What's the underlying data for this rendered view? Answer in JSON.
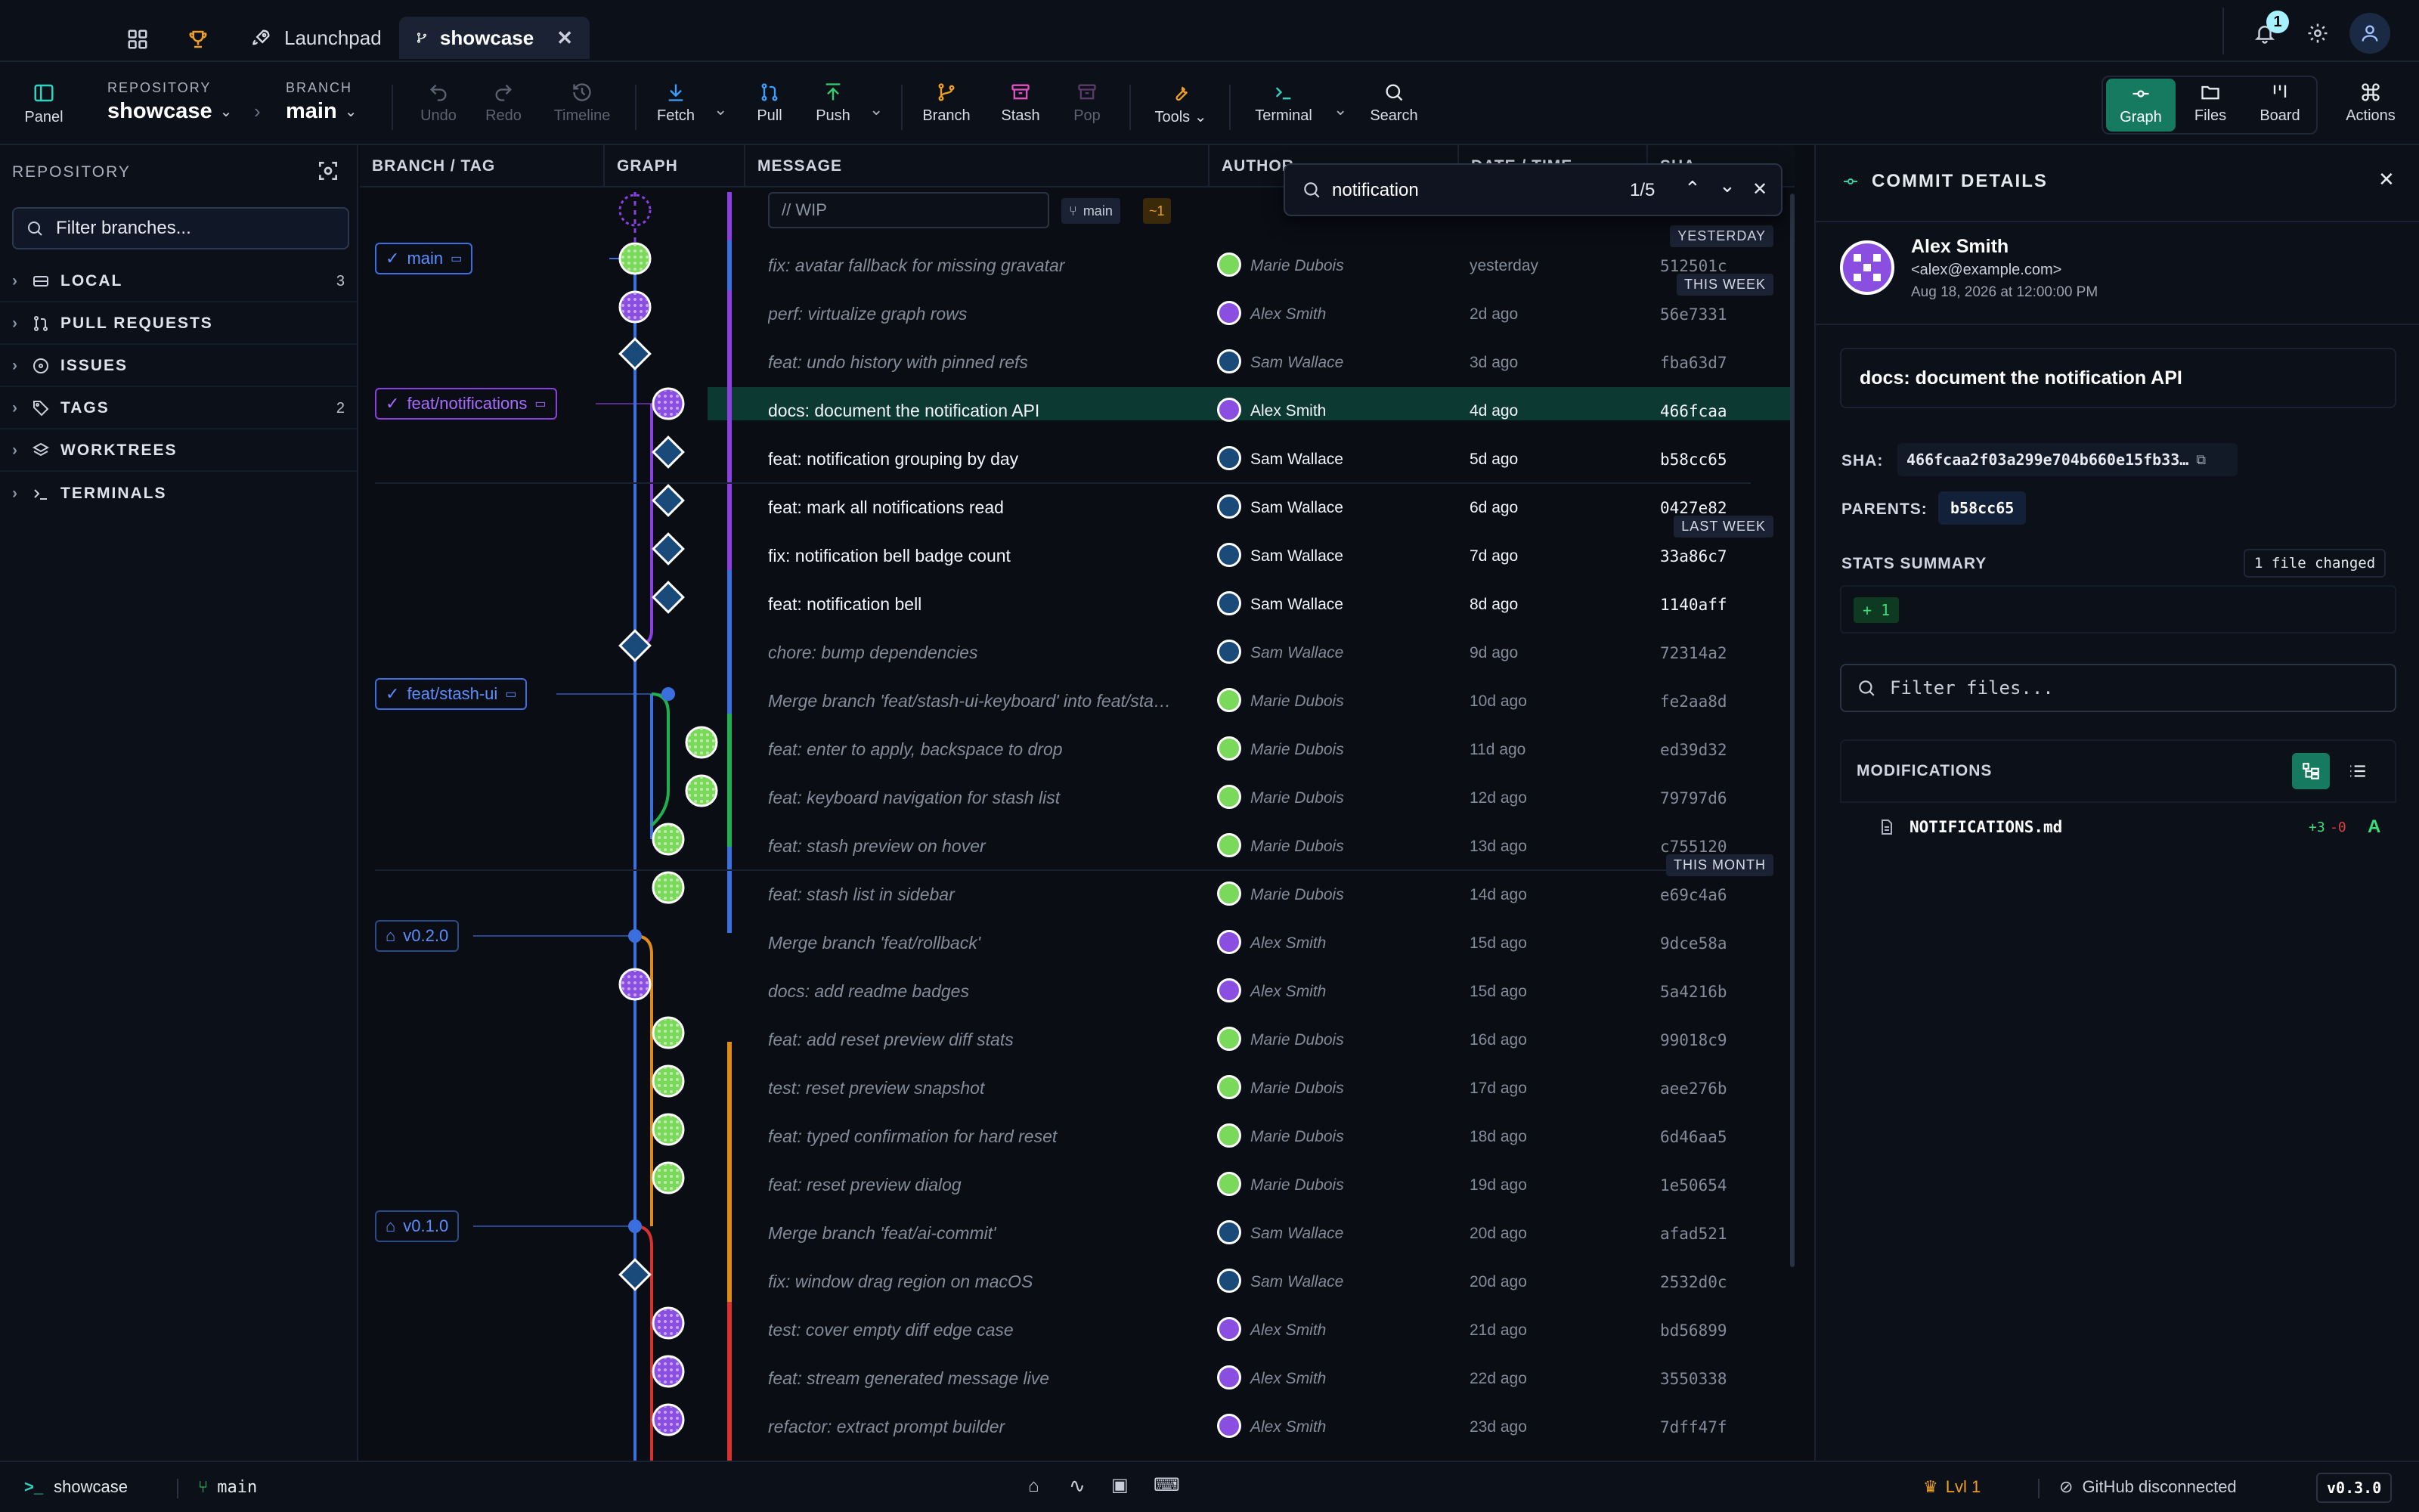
{
  "tabs": {
    "launchpad_label": "Launchpad",
    "showcase_label": "showcase",
    "notification_badge": "1"
  },
  "toolbar": {
    "panel": "Panel",
    "repo_caption": "REPOSITORY",
    "repo_name": "showcase",
    "branch_caption": "BRANCH",
    "branch_name": "main",
    "undo": "Undo",
    "redo": "Redo",
    "timeline": "Timeline",
    "fetch": "Fetch",
    "pull": "Pull",
    "push": "Push",
    "branch": "Branch",
    "stash": "Stash",
    "pop": "Pop",
    "tools": "Tools",
    "terminal": "Terminal",
    "search": "Search",
    "graph": "Graph",
    "files": "Files",
    "board": "Board",
    "actions": "Actions"
  },
  "sidebar": {
    "title": "REPOSITORY",
    "filter_placeholder": "Filter branches...",
    "sections": [
      {
        "label": "LOCAL",
        "count": "3"
      },
      {
        "label": "PULL REQUESTS",
        "count": ""
      },
      {
        "label": "ISSUES",
        "count": ""
      },
      {
        "label": "TAGS",
        "count": "2"
      },
      {
        "label": "WORKTREES",
        "count": ""
      },
      {
        "label": "TERMINALS",
        "count": ""
      }
    ]
  },
  "columns": {
    "branch_tag": "BRANCH / TAG",
    "graph": "GRAPH",
    "message": "MESSAGE",
    "author": "AUTHOR",
    "datetime": "DATE / TIME",
    "sha": "SHA"
  },
  "search": {
    "query": "notification",
    "counter": "1/5"
  },
  "wip": {
    "placeholder": "// WIP",
    "branch": "main",
    "changes": "~1"
  },
  "date_groups": {
    "yesterday": "YESTERDAY",
    "this_week": "THIS WEEK",
    "last_week": "LAST WEEK",
    "this_month": "THIS MONTH"
  },
  "refs": {
    "main": "main",
    "feat_notifications": "feat/notifications",
    "feat_stash_ui": "feat/stash-ui",
    "v020": "v0.2.0",
    "v010": "v0.1.0"
  },
  "commits": [
    {
      "message": "fix: avatar fallback for missing gravatar",
      "author": "Marie Dubois",
      "date": "yesterday",
      "sha": "512501c"
    },
    {
      "message": "perf: virtualize graph rows",
      "author": "Alex Smith",
      "date": "2d ago",
      "sha": "56e7331"
    },
    {
      "message": "feat: undo history with pinned refs",
      "author": "Sam Wallace",
      "date": "3d ago",
      "sha": "fba63d7"
    },
    {
      "message": "docs: document the notification API",
      "author": "Alex Smith",
      "date": "4d ago",
      "sha": "466fcaa"
    },
    {
      "message": "feat: notification grouping by day",
      "author": "Sam Wallace",
      "date": "5d ago",
      "sha": "b58cc65"
    },
    {
      "message": "feat: mark all notifications read",
      "author": "Sam Wallace",
      "date": "6d ago",
      "sha": "0427e82"
    },
    {
      "message": "fix: notification bell badge count",
      "author": "Sam Wallace",
      "date": "7d ago",
      "sha": "33a86c7"
    },
    {
      "message": "feat: notification bell",
      "author": "Sam Wallace",
      "date": "8d ago",
      "sha": "1140aff"
    },
    {
      "message": "chore: bump dependencies",
      "author": "Sam Wallace",
      "date": "9d ago",
      "sha": "72314a2"
    },
    {
      "message": "Merge branch 'feat/stash-ui-keyboard' into feat/sta…",
      "author": "Marie Dubois",
      "date": "10d ago",
      "sha": "fe2aa8d"
    },
    {
      "message": "feat: enter to apply, backspace to drop",
      "author": "Marie Dubois",
      "date": "11d ago",
      "sha": "ed39d32"
    },
    {
      "message": "feat: keyboard navigation for stash list",
      "author": "Marie Dubois",
      "date": "12d ago",
      "sha": "79797d6"
    },
    {
      "message": "feat: stash preview on hover",
      "author": "Marie Dubois",
      "date": "13d ago",
      "sha": "c755120"
    },
    {
      "message": "feat: stash list in sidebar",
      "author": "Marie Dubois",
      "date": "14d ago",
      "sha": "e69c4a6"
    },
    {
      "message": "Merge branch 'feat/rollback'",
      "author": "Alex Smith",
      "date": "15d ago",
      "sha": "9dce58a"
    },
    {
      "message": "docs: add readme badges",
      "author": "Alex Smith",
      "date": "15d ago",
      "sha": "5a4216b"
    },
    {
      "message": "feat: add reset preview diff stats",
      "author": "Marie Dubois",
      "date": "16d ago",
      "sha": "99018c9"
    },
    {
      "message": "test: reset preview snapshot",
      "author": "Marie Dubois",
      "date": "17d ago",
      "sha": "aee276b"
    },
    {
      "message": "feat: typed confirmation for hard reset",
      "author": "Marie Dubois",
      "date": "18d ago",
      "sha": "6d46aa5"
    },
    {
      "message": "feat: reset preview dialog",
      "author": "Marie Dubois",
      "date": "19d ago",
      "sha": "1e50654"
    },
    {
      "message": "Merge branch 'feat/ai-commit'",
      "author": "Sam Wallace",
      "date": "20d ago",
      "sha": "afad521"
    },
    {
      "message": "fix: window drag region on macOS",
      "author": "Sam Wallace",
      "date": "20d ago",
      "sha": "2532d0c"
    },
    {
      "message": "test: cover empty diff edge case",
      "author": "Alex Smith",
      "date": "21d ago",
      "sha": "bd56899"
    },
    {
      "message": "feat: stream generated message live",
      "author": "Alex Smith",
      "date": "22d ago",
      "sha": "3550338"
    },
    {
      "message": "refactor: extract prompt builder",
      "author": "Alex Smith",
      "date": "23d ago",
      "sha": "7dff47f"
    }
  ],
  "details": {
    "title": "COMMIT DETAILS",
    "author_name": "Alex Smith",
    "author_email": "<alex@example.com>",
    "author_date": "Aug 18, 2026 at 12:00:00 PM",
    "message": "docs: document the notification API",
    "sha_label": "SHA:",
    "sha_value": "466fcaa2f03a299e704b660e15fb33…",
    "parents_label": "PARENTS:",
    "parent_value": "b58cc65",
    "stats_label": "STATS SUMMARY",
    "files_changed": "1 file changed",
    "additions": "+ 1",
    "filter_placeholder": "Filter files...",
    "modifications_label": "MODIFICATIONS",
    "file_name": "NOTIFICATIONS.md",
    "file_plus": "+3",
    "file_minus": "-0",
    "file_status": "A"
  },
  "statusbar": {
    "repo": "showcase",
    "branch": "main",
    "level": "Lvl 1",
    "github": "GitHub disconnected",
    "version": "v0.3.0"
  },
  "colors": {
    "accent_green": "#19a67a",
    "lane_blue": "#3b6fe0",
    "lane_purple": "#8a3fe0",
    "lane_green": "#1fb050",
    "lane_orange": "#e08a1a",
    "lane_red": "#d93030",
    "selected_row": "#0c3a33"
  }
}
